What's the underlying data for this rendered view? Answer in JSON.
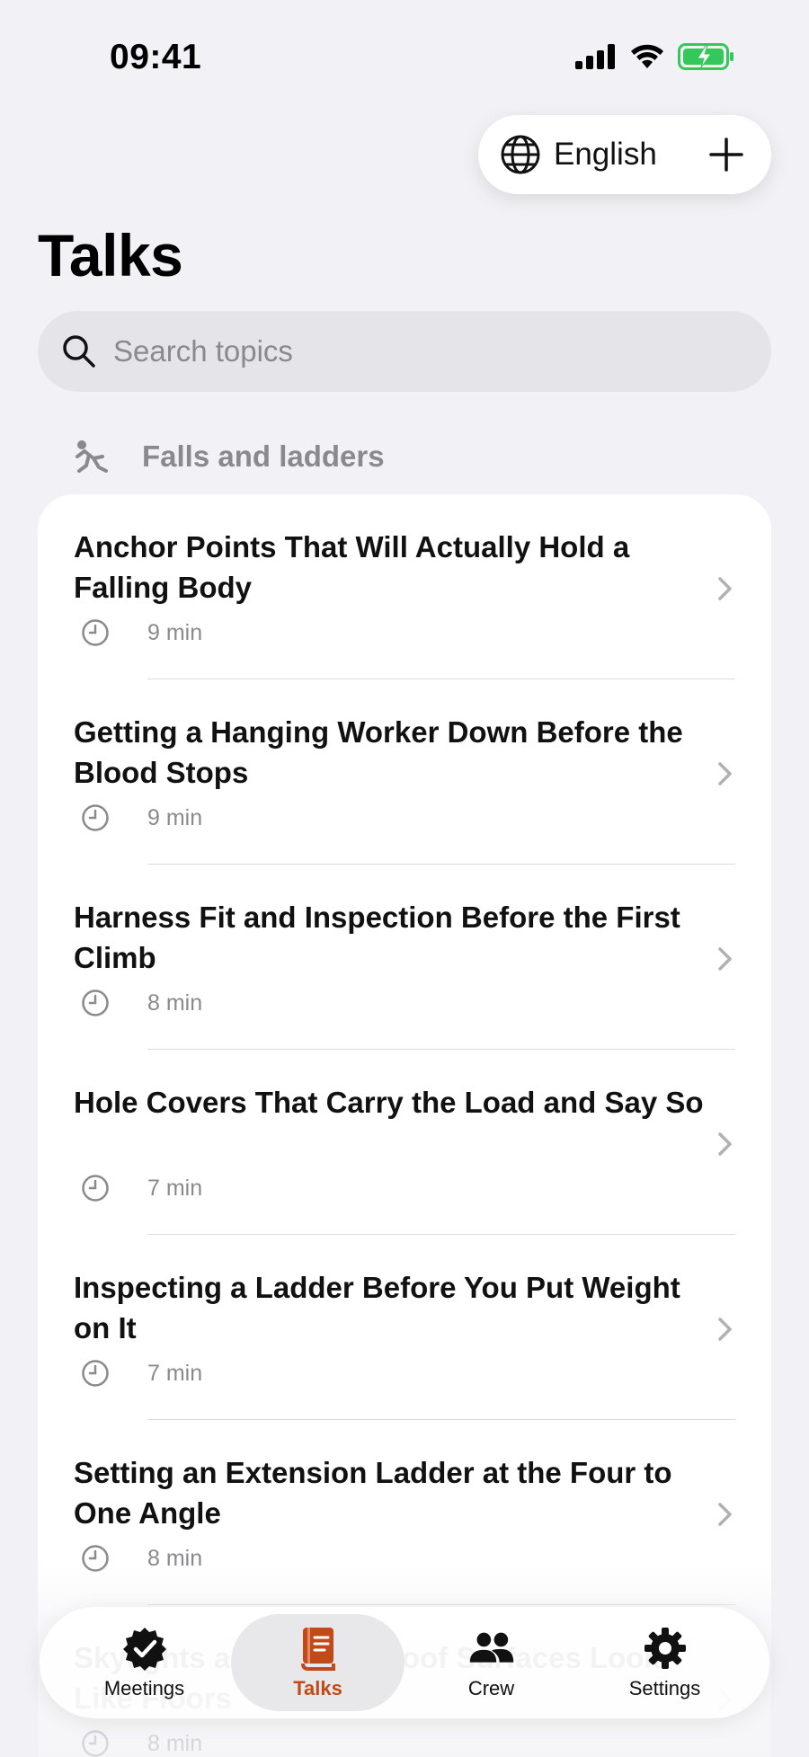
{
  "status_bar": {
    "time": "09:41"
  },
  "language": {
    "label": "English"
  },
  "page": {
    "title": "Talks"
  },
  "search": {
    "placeholder": "Search topics",
    "value": ""
  },
  "section": {
    "title": "Falls and ladders"
  },
  "talks": [
    {
      "title": "Anchor Points That Will Actually Hold a Falling Body",
      "duration": "9 min"
    },
    {
      "title": "Getting a Hanging Worker Down Before the Blood Stops",
      "duration": "9 min"
    },
    {
      "title": "Harness Fit and Inspection Before the First Climb",
      "duration": "8 min"
    },
    {
      "title": "Hole Covers That Carry the Load and Say So",
      "duration": "7 min"
    },
    {
      "title": "Inspecting a Ladder Before You Put Weight on It",
      "duration": "7 min"
    },
    {
      "title": "Setting an Extension Ladder at the Four to One Angle",
      "duration": "8 min"
    },
    {
      "title": "Skylights and Fragile Roof Surfaces Look Like Floors",
      "duration": "8 min"
    }
  ],
  "tabs": [
    {
      "label": "Meetings",
      "icon": "checkmark-seal-icon"
    },
    {
      "label": "Talks",
      "icon": "book-icon"
    },
    {
      "label": "Crew",
      "icon": "people-icon"
    },
    {
      "label": "Settings",
      "icon": "gear-icon"
    }
  ],
  "colors": {
    "accent": "#c24a18",
    "battery": "#34c759",
    "background": "#f2f2f6"
  }
}
